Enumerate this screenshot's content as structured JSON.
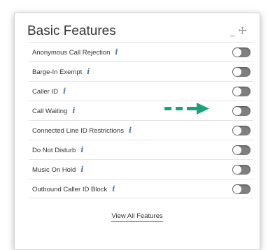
{
  "panel": {
    "title": "Basic Features",
    "minimize_icon": "minimize-icon",
    "move_icon": "move-icon"
  },
  "features": [
    {
      "label": "Anonymous Call Rejection",
      "enabled": false
    },
    {
      "label": "Barge-In Exempt",
      "enabled": false
    },
    {
      "label": "Caller ID",
      "enabled": false
    },
    {
      "label": "Call Waiting",
      "enabled": false
    },
    {
      "label": "Connected Line ID Restrictions",
      "enabled": false
    },
    {
      "label": "Do Not Disturb",
      "enabled": false
    },
    {
      "label": "Music On Hold",
      "enabled": false
    },
    {
      "label": "Outbound Caller ID Block",
      "enabled": false
    }
  ],
  "info_icon": "i",
  "view_all_label": "View All Features",
  "colors": {
    "info_icon": "#4d7cb0",
    "toggle_off": "#7f7f7f",
    "annotation_arrow": "#1aa37a"
  }
}
